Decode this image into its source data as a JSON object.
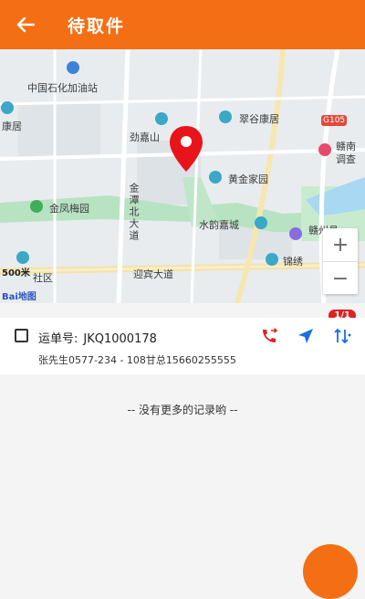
{
  "header": {
    "title": "待取件"
  },
  "map": {
    "labels": {
      "gas_station": "中国石化加油站",
      "kangju_left": "康居",
      "jiajia": "劲嘉山",
      "cuigu": "翠谷康居",
      "g105": "G105",
      "ganzhou": "赣南",
      "survey": "调查",
      "huangjin": "黄金家园",
      "jinfeng": "金凤梅园",
      "jintan": "金潭北大道",
      "shuiyun": "水韵嘉城",
      "ganzhou_xian": "赣州县",
      "jinxiu": "锦绣",
      "yingbin": "迎宾大道",
      "community": "社区",
      "scale": "500米",
      "baidu": "Bai地图"
    },
    "zoom_in": "+",
    "zoom_out": "−"
  },
  "order": {
    "waybill_label": "运单号:",
    "waybill_no": "JKQ1000178",
    "contact": "张先生0577-234 - 108甘总15660255555",
    "badge": "1/1"
  },
  "list": {
    "no_more": "-- 没有更多的记录哟 --"
  },
  "colors": {
    "brand": "#f46f14",
    "accent_blue": "#1a6fe0",
    "badge": "#e02020"
  }
}
